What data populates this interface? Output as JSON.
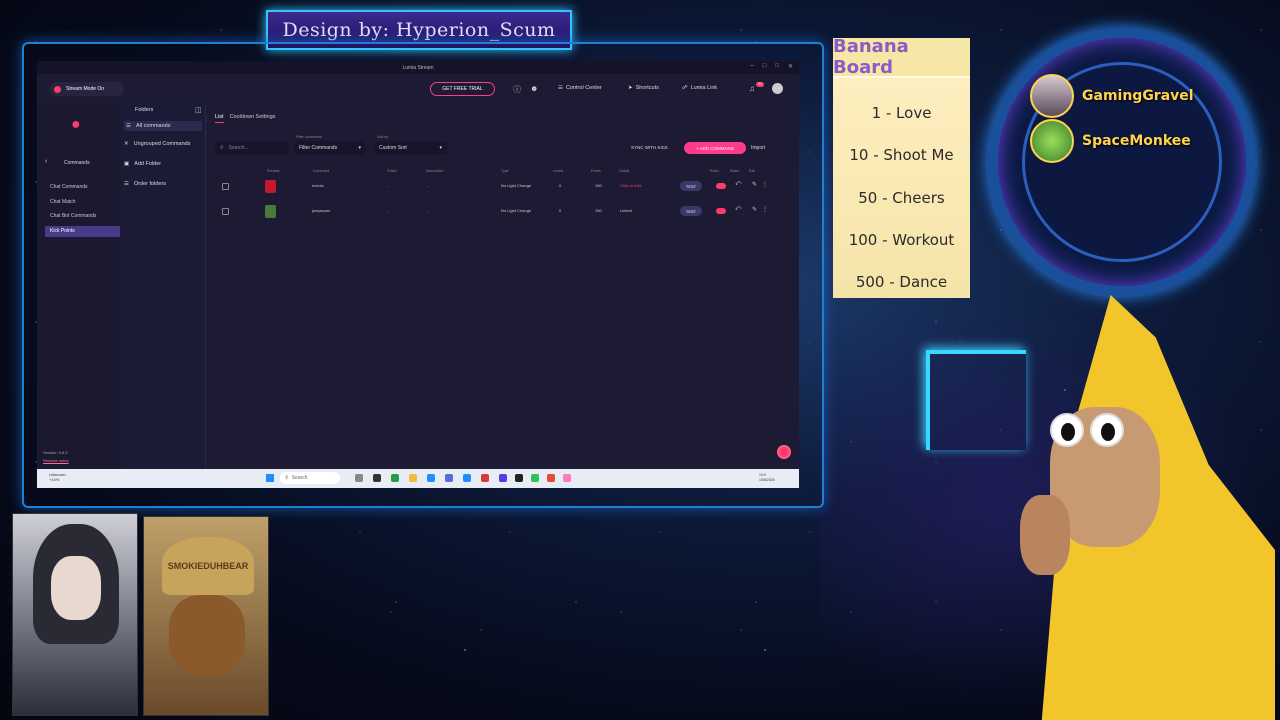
{
  "banner": {
    "text": "Design by: Hyperion_Scum"
  },
  "window": {
    "title": "Lumia Stream"
  },
  "topbar": {
    "stream_mode": "Stream Mode On",
    "free_trial": "GET FREE TRIAL",
    "control_center": "Control Center",
    "shortcuts": "Shortcuts",
    "lumia_link": "Lumia Link",
    "notif_count": "31"
  },
  "nav1": {
    "title": "Commands",
    "items": [
      "Chat Commands",
      "Chat Match",
      "Chat Bot Commands",
      "Kick Points"
    ],
    "version": "Version: 9.6.3",
    "release_notes": "Release notes"
  },
  "nav2": {
    "header": "Folders",
    "all": "All commands",
    "ungrouped": "Ungrouped Commands",
    "add_folder": "Add Folder",
    "order_folders": "Order folders"
  },
  "main": {
    "tabs": [
      "List",
      "Cooldown Settings"
    ],
    "search_placeholder": "Search...",
    "filter_label": "Filter commands",
    "filter_value": "Filter Commands",
    "sort_label": "Sort by",
    "sort_value": "Custom Sort",
    "sync": "SYNC WITH KICK",
    "add": "+ ADD COMMAND",
    "import": "Import",
    "columns": [
      "Preview",
      "Command",
      "Folder",
      "Description",
      "Type",
      "Levels",
      "Points",
      "Global",
      "Rules",
      "Share",
      "Edit"
    ],
    "rows": [
      {
        "command": "ecbols",
        "folder": "-",
        "description": "-",
        "type": "No Light Change",
        "levels": "0",
        "points": "150",
        "global": "Click to Edit",
        "test": "TEST",
        "preview_color": "#c4182e"
      },
      {
        "command": "jumpscare",
        "folder": "-",
        "description": "-",
        "type": "No Light Change",
        "levels": "0",
        "points": "150",
        "global": "Linked",
        "test": "TEST",
        "preview_color": "#4a7a3a"
      }
    ]
  },
  "taskbar": {
    "weather": [
      "Unknown",
      "+14%"
    ],
    "search": "Search",
    "time": [
      "10:0",
      "10/8/2025"
    ]
  },
  "banana_board": {
    "title": "Banana Board",
    "entries": [
      "1 - Love",
      "10 - Shoot Me",
      "50 - Cheers",
      "100 - Workout",
      "500 - Dance"
    ]
  },
  "subs": [
    "GamingGravel",
    "SpaceMonkee"
  ],
  "cam2": {
    "hat_text": "SMOKIEDUHBEAR"
  },
  "colors": {
    "accent": "#ff3b6b",
    "app_bg": "#1c1b33",
    "frame": "#1e7fd6",
    "board": "#f5e4a8"
  }
}
